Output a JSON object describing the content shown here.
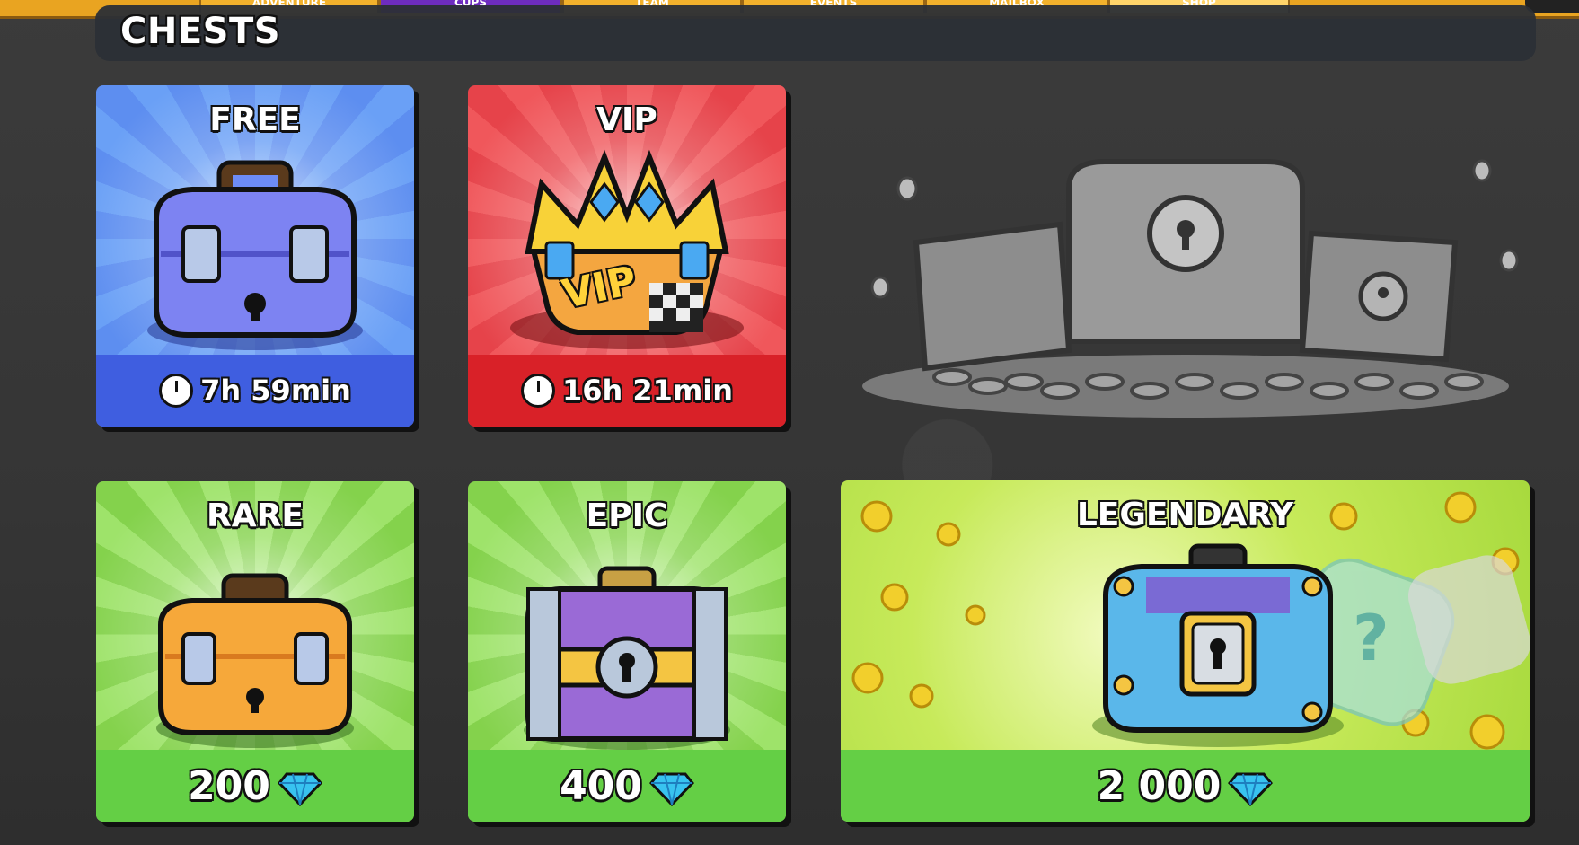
{
  "top_tabs": [
    {
      "label": "ADVENTURE"
    },
    {
      "label": "CUPS"
    },
    {
      "label": "TEAM"
    },
    {
      "label": "EVENTS"
    },
    {
      "label": "MAILBOX"
    },
    {
      "label": "SHOP"
    }
  ],
  "section": {
    "title": "CHESTS"
  },
  "cards": {
    "free": {
      "label": "FREE",
      "timer": "7h 59min"
    },
    "vip": {
      "label": "VIP",
      "timer": "16h 21min",
      "chest_text": "VIP"
    },
    "rare": {
      "label": "RARE",
      "price": "200"
    },
    "epic": {
      "label": "EPIC",
      "price": "400"
    },
    "legendary": {
      "label": "LEGENDARY",
      "price": "2 000"
    }
  },
  "colors": {
    "free_footer": "#3f5ee0",
    "vip_footer": "#d92128",
    "green_footer": "#64cf45",
    "tab_bar": "#e9a421"
  },
  "icons": {
    "timer": "clock-icon",
    "currency": "gem-icon"
  }
}
